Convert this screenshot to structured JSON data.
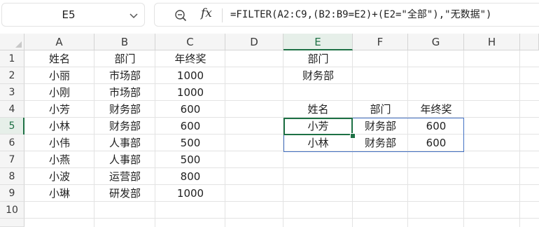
{
  "name_box": {
    "value": "E5"
  },
  "formula_bar": {
    "fx_label": "fx",
    "formula": "=FILTER(A2:C9,(B2:B9=E2)+(E2=\"全部\"),\"无数据\")"
  },
  "columns": [
    "A",
    "B",
    "C",
    "D",
    "E",
    "F",
    "G",
    "H"
  ],
  "rows": [
    "1",
    "2",
    "3",
    "4",
    "5",
    "6",
    "7",
    "8",
    "9",
    "10",
    ""
  ],
  "active": {
    "column": "E",
    "row": "5"
  },
  "table": {
    "headers": [
      "姓名",
      "部门",
      "年终奖"
    ],
    "rows": [
      [
        "小丽",
        "市场部",
        "1000"
      ],
      [
        "小刚",
        "市场部",
        "1000"
      ],
      [
        "小芳",
        "财务部",
        "600"
      ],
      [
        "小林",
        "财务部",
        "600"
      ],
      [
        "小伟",
        "人事部",
        "500"
      ],
      [
        "小燕",
        "人事部",
        "500"
      ],
      [
        "小波",
        "运营部",
        "800"
      ],
      [
        "小琳",
        "研发部",
        "1000"
      ]
    ]
  },
  "criteria": {
    "label": "部门",
    "value": "财务部"
  },
  "result": {
    "headers": [
      "姓名",
      "部门",
      "年终奖"
    ],
    "rows": [
      [
        "小芳",
        "财务部",
        "600"
      ],
      [
        "小林",
        "财务部",
        "600"
      ]
    ]
  }
}
